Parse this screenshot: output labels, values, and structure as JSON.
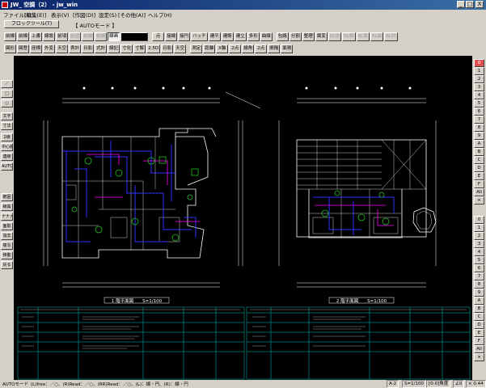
{
  "window": {
    "title": "JW_  空調（2） - jw_win",
    "min_label": "_",
    "max_label": "□",
    "close_label": "X"
  },
  "menu": [
    "ファイル(F)",
    "[編集(E)]",
    "表示(V)",
    "[作図(D)]",
    "設定(S)",
    "[その他(A)]",
    "ヘルプ(H)"
  ],
  "toolbar": {
    "block_button": "ブロックツール(T)",
    "mode_label": "【 AUTOモード 】",
    "row2": [
      {
        "label": "前線"
      },
      {
        "label": "前線"
      },
      {
        "label": "上書"
      },
      {
        "label": "線設"
      },
      {
        "label": "前項"
      },
      {
        "label": "前値",
        "dis": true
      },
      {
        "label": "前線",
        "dis": true
      },
      {
        "label": "前線",
        "dis": true
      },
      {
        "label": "線画",
        "sel": true
      },
      {
        "label": "",
        "blk": true
      },
      {
        "label": "点",
        "sep": true
      },
      {
        "label": "接線"
      },
      {
        "label": "接円"
      },
      {
        "label": "ハッチ"
      },
      {
        "label": "建平"
      },
      {
        "label": "建断"
      },
      {
        "label": "建立"
      },
      {
        "label": "多形"
      },
      {
        "label": "曲線"
      },
      {
        "label": "包絡",
        "sep": true
      },
      {
        "label": "分割"
      },
      {
        "label": "整理"
      },
      {
        "label": "属変"
      },
      {
        "label": "BL化",
        "dis": true
      },
      {
        "label": "BL解",
        "dis": true
      },
      {
        "label": "BL属",
        "dis": true
      },
      {
        "label": "BL編",
        "dis": true
      },
      {
        "label": "BL終",
        "dis": true
      }
    ],
    "row3": [
      {
        "label": "図形"
      },
      {
        "label": "図登"
      },
      {
        "label": "座標"
      },
      {
        "label": "外変"
      },
      {
        "label": "天空"
      },
      {
        "label": "表計"
      },
      {
        "label": "日影"
      },
      {
        "label": "式計"
      },
      {
        "label": "線記"
      },
      {
        "label": "寸化"
      },
      {
        "label": "寸解"
      },
      {
        "label": "2.5D"
      },
      {
        "label": "日影"
      },
      {
        "label": "天空"
      },
      {
        "label": "測定",
        "sep": true
      },
      {
        "label": "距離"
      },
      {
        "label": "X軸"
      },
      {
        "label": "2点"
      },
      {
        "label": "線角"
      },
      {
        "label": "2点"
      },
      {
        "label": "間隔"
      },
      {
        "label": "面積"
      }
    ]
  },
  "left_tools": [
    "／",
    "□",
    "○",
    "文字",
    "寸法",
    "2線",
    "中心線",
    "連線",
    "AUTO",
    "範囲",
    "線属",
    "ナナメ",
    "面取",
    "消去",
    "複写",
    "移動",
    "戻る"
  ],
  "right_layers": [
    "0",
    "1",
    "2",
    "3",
    "4",
    "5",
    "6",
    "7",
    "8",
    "9",
    "A",
    "B",
    "C",
    "D",
    "E",
    "F",
    "All",
    "×",
    "0",
    "1",
    "2",
    "3",
    "4",
    "5",
    "6",
    "7",
    "8",
    "9",
    "A",
    "B",
    "C",
    "D",
    "E",
    "F",
    "All",
    "×"
  ],
  "drawing": {
    "plan1_label": "1 階平面図　　S=1/100",
    "plan2_label": "2 階平面図　　S=1/100"
  },
  "status": {
    "mode": "AUTOモード",
    "hint": "(L)free：／○、(R)Read：／○、(RR)Read：／○、(L)：線・円、(R)：線・円",
    "layer": "A-2",
    "scale": "S=1/100",
    "angle": "[0-0]角度",
    "zoom": "∠0",
    "factor": "× 0.44"
  },
  "colors": {
    "canvas": "#000000",
    "wall": "#ffffff",
    "duct": "#3030ff",
    "device": "#20c020",
    "magenta": "#ff00ff",
    "table": "#00c0c0",
    "title_bar": "#0a246a"
  }
}
